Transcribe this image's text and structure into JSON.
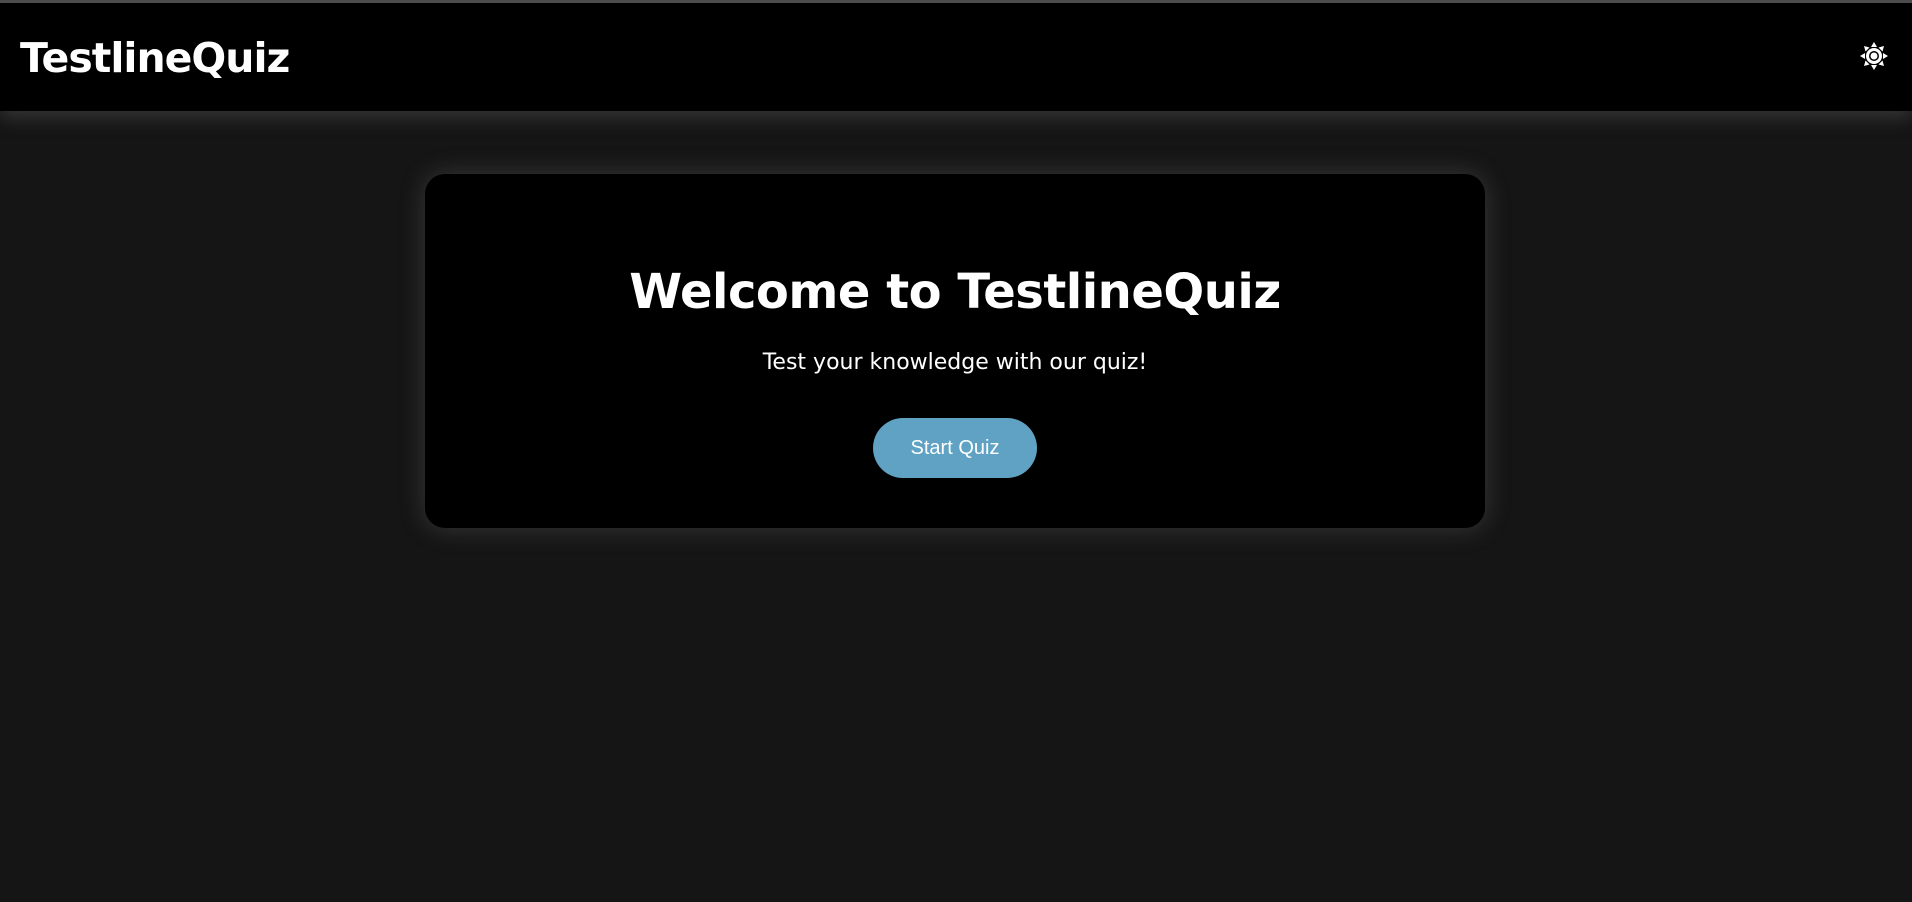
{
  "header": {
    "brand": "TestlineQuiz",
    "theme_toggle_icon": "sun-icon"
  },
  "hero": {
    "title": "Welcome to TestlineQuiz",
    "subtitle": "Test your knowledge with our quiz!",
    "start_button_label": "Start Quiz"
  },
  "colors": {
    "page_background": "#151515",
    "header_background": "#000000",
    "card_background": "#000000",
    "button_background": "#5fa2c4",
    "text": "#ffffff"
  }
}
